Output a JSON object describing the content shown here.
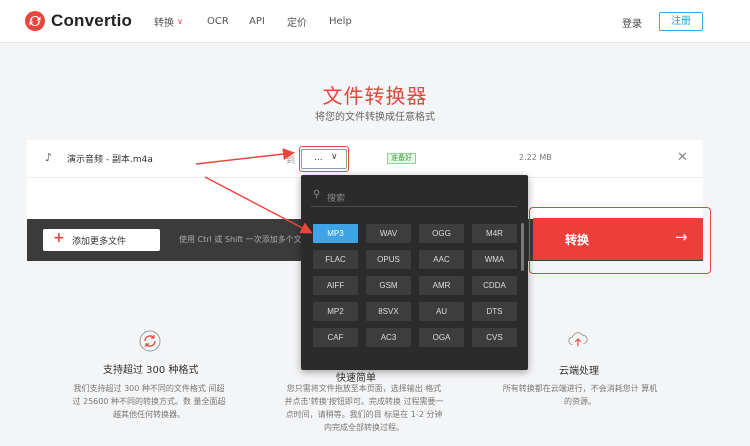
{
  "header": {
    "brand": "Convertio",
    "nav": [
      {
        "label": "转换",
        "has_dropdown": true
      },
      {
        "label": "OCR"
      },
      {
        "label": "API"
      },
      {
        "label": "定价"
      },
      {
        "label": "Help"
      }
    ],
    "login": "登录",
    "signup": "注册"
  },
  "hero": {
    "title": "文件转换器",
    "subtitle": "将您的文件转换成任意格式"
  },
  "file": {
    "name": "演示音频 - 副本.m4a",
    "to_label": "到",
    "format_value": "...",
    "status": "准备好",
    "size": "2.22 MB"
  },
  "actions": {
    "add_more": "添加更多文件",
    "hint": "使用 Ctrl 或 Shift 一次添加多个文件",
    "convert": "转换"
  },
  "format_popover": {
    "search_placeholder": "搜索",
    "formats": [
      "MP3",
      "WAV",
      "OGG",
      "M4R",
      "FLAC",
      "OPUS",
      "AAC",
      "WMA",
      "AIFF",
      "GSM",
      "AMR",
      "CDDA",
      "MP2",
      "8SVX",
      "AU",
      "DTS",
      "CAF",
      "AC3",
      "OGA",
      "CVS"
    ],
    "selected": "MP3"
  },
  "features": [
    {
      "title": "支持超过 300 种格式",
      "desc": "我们支持超过 300 种不同的文件格式 间超过 25600 种不同的转换方式。数 量全面超越其他任何转换器。"
    },
    {
      "title": "快速简单",
      "desc": "您只需将文件拖放至本页面，选择输出 格式并点击'转换'按钮即可。完成转换 过程需要一点时间，请稍等。我们的目 标是在 1-2 分钟内完成全部转换过程。"
    },
    {
      "title": "云端处理",
      "desc": "所有转换都在云端进行，不会消耗您计 算机的资源。"
    }
  ],
  "colors": {
    "brand_red": "#ee3e3a",
    "accent_blue": "#3ea4e6",
    "dark_bar": "#3b3b3b",
    "popover_bg": "#2b2b2b"
  }
}
